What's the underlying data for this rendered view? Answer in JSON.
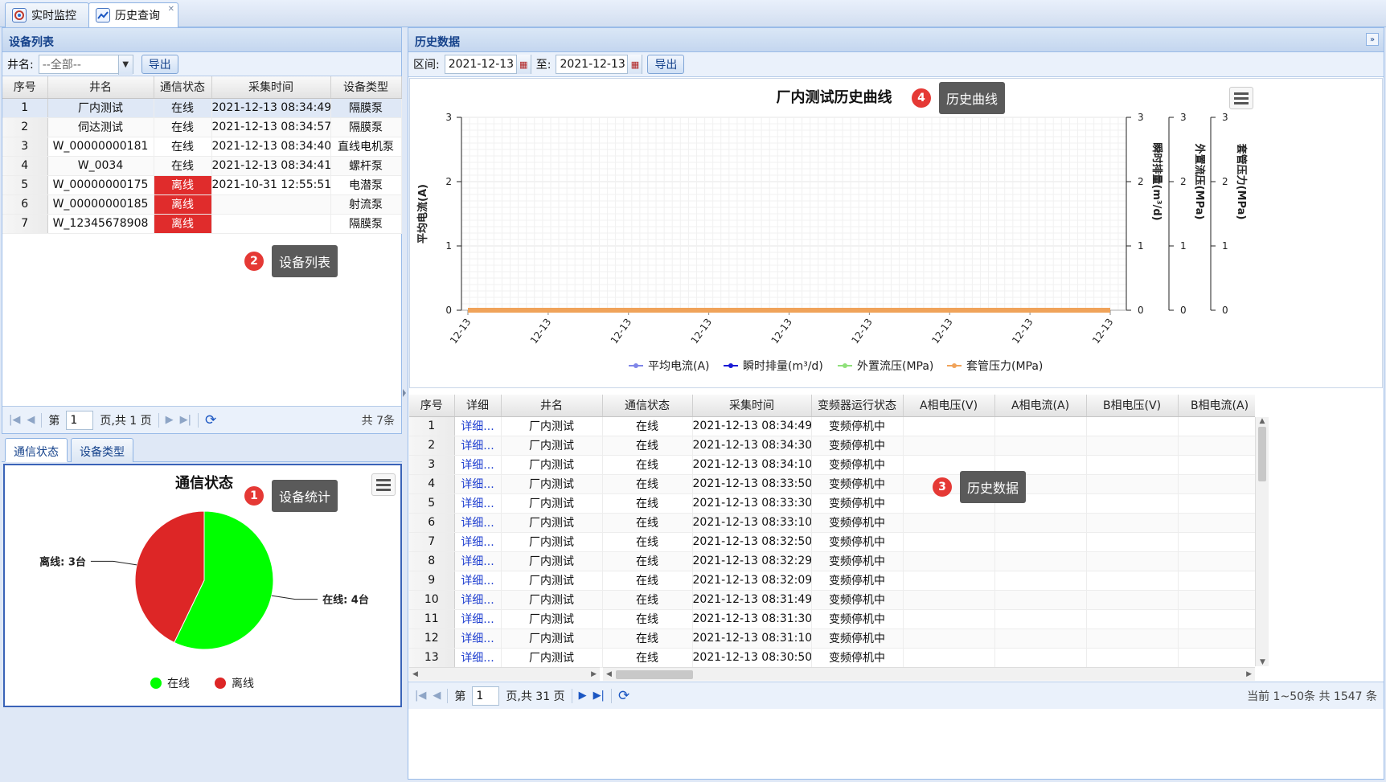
{
  "tabs": [
    {
      "label": "实时监控",
      "icon": "monitor-icon"
    },
    {
      "label": "历史查询",
      "icon": "line-chart-icon"
    }
  ],
  "device_panel": {
    "title": "设备列表",
    "filter_label": "井名:",
    "filter_value": "--全部--",
    "export_label": "导出",
    "columns": [
      "序号",
      "井名",
      "通信状态",
      "采集时间",
      "设备类型"
    ],
    "rows": [
      {
        "no": "1",
        "name": "厂内测试",
        "status": "在线",
        "time": "2021-12-13 08:34:49",
        "type": "隔膜泵"
      },
      {
        "no": "2",
        "name": "伺达测试",
        "status": "在线",
        "time": "2021-12-13 08:34:57",
        "type": "隔膜泵"
      },
      {
        "no": "3",
        "name": "W_00000000181",
        "status": "在线",
        "time": "2021-12-13 08:34:40",
        "type": "直线电机泵"
      },
      {
        "no": "4",
        "name": "W_0034",
        "status": "在线",
        "time": "2021-12-13 08:34:41",
        "type": "螺杆泵"
      },
      {
        "no": "5",
        "name": "W_00000000175",
        "status": "离线",
        "time": "2021-10-31 12:55:51",
        "type": "电潜泵"
      },
      {
        "no": "6",
        "name": "W_00000000185",
        "status": "离线",
        "time": "",
        "type": "射流泵"
      },
      {
        "no": "7",
        "name": "W_12345678908",
        "status": "离线",
        "time": "",
        "type": "隔膜泵"
      }
    ],
    "pager": {
      "page_prefix": "第",
      "page_value": "1",
      "page_suffix": "页,共 1 页",
      "total": "共 7条"
    }
  },
  "stats_panel": {
    "tabs": [
      "通信状态",
      "设备类型"
    ],
    "chart_title": "通信状态",
    "legend": [
      "在线",
      "离线"
    ],
    "labels": [
      "离线: 3台",
      "在线: 4台"
    ]
  },
  "history_panel": {
    "title": "历史数据",
    "range_label": "区间:",
    "start_date": "2021-12-13",
    "to_label": "至:",
    "end_date": "2021-12-13",
    "export_label": "导出",
    "chart_title": "厂内测试历史曲线",
    "y_axis_left": "平均电流(A)",
    "y_axis_right": [
      "瞬时排量(m³/d)",
      "外置流压(MPa)",
      "套管压力(MPa)"
    ],
    "legend": [
      "平均电流(A)",
      "瞬时排量(m³/d)",
      "外置流压(MPa)",
      "套管压力(MPa)"
    ],
    "x_tick_label": "12-13",
    "y_ticks": [
      "0",
      "1",
      "2",
      "3"
    ],
    "columns": [
      "序号",
      "详细",
      "井名",
      "通信状态",
      "采集时间",
      "变频器运行状态",
      "A相电压(V)",
      "A相电流(A)",
      "B相电压(V)",
      "B相电流(A)"
    ],
    "rows": [
      {
        "no": "1",
        "detail": "详细...",
        "name": "厂内测试",
        "status": "在线",
        "time": "2021-12-13 08:34:49",
        "vfd": "变频停机中"
      },
      {
        "no": "2",
        "detail": "详细...",
        "name": "厂内测试",
        "status": "在线",
        "time": "2021-12-13 08:34:30",
        "vfd": "变频停机中"
      },
      {
        "no": "3",
        "detail": "详细...",
        "name": "厂内测试",
        "status": "在线",
        "time": "2021-12-13 08:34:10",
        "vfd": "变频停机中"
      },
      {
        "no": "4",
        "detail": "详细...",
        "name": "厂内测试",
        "status": "在线",
        "time": "2021-12-13 08:33:50",
        "vfd": "变频停机中"
      },
      {
        "no": "5",
        "detail": "详细...",
        "name": "厂内测试",
        "status": "在线",
        "time": "2021-12-13 08:33:30",
        "vfd": "变频停机中"
      },
      {
        "no": "6",
        "detail": "详细...",
        "name": "厂内测试",
        "status": "在线",
        "time": "2021-12-13 08:33:10",
        "vfd": "变频停机中"
      },
      {
        "no": "7",
        "detail": "详细...",
        "name": "厂内测试",
        "status": "在线",
        "time": "2021-12-13 08:32:50",
        "vfd": "变频停机中"
      },
      {
        "no": "8",
        "detail": "详细...",
        "name": "厂内测试",
        "status": "在线",
        "time": "2021-12-13 08:32:29",
        "vfd": "变频停机中"
      },
      {
        "no": "9",
        "detail": "详细...",
        "name": "厂内测试",
        "status": "在线",
        "time": "2021-12-13 08:32:09",
        "vfd": "变频停机中"
      },
      {
        "no": "10",
        "detail": "详细...",
        "name": "厂内测试",
        "status": "在线",
        "time": "2021-12-13 08:31:49",
        "vfd": "变频停机中"
      },
      {
        "no": "11",
        "detail": "详细...",
        "name": "厂内测试",
        "status": "在线",
        "time": "2021-12-13 08:31:30",
        "vfd": "变频停机中"
      },
      {
        "no": "12",
        "detail": "详细...",
        "name": "厂内测试",
        "status": "在线",
        "time": "2021-12-13 08:31:10",
        "vfd": "变频停机中"
      },
      {
        "no": "13",
        "detail": "详细...",
        "name": "厂内测试",
        "status": "在线",
        "time": "2021-12-13 08:30:50",
        "vfd": "变频停机中"
      }
    ],
    "pager": {
      "page_prefix": "第",
      "page_value": "1",
      "page_suffix": "页,共 31 页",
      "total": "当前 1~50条 共 1547 条"
    }
  },
  "callouts": [
    {
      "num": "1",
      "text": "设备统计"
    },
    {
      "num": "2",
      "text": "设备列表"
    },
    {
      "num": "3",
      "text": "历史数据"
    },
    {
      "num": "4",
      "text": "历史曲线"
    }
  ],
  "chart_data": [
    {
      "type": "pie",
      "title": "通信状态",
      "categories": [
        "在线",
        "离线"
      ],
      "values": [
        4,
        3
      ],
      "colors": [
        "#00ff00",
        "#dd2626"
      ],
      "data_labels": [
        "在线: 4台",
        "离线: 3台"
      ],
      "legend": "bottom"
    },
    {
      "type": "line",
      "title": "厂内测试历史曲线",
      "x": [
        "12-13",
        "12-13",
        "12-13",
        "12-13",
        "12-13",
        "12-13",
        "12-13",
        "12-13",
        "12-13"
      ],
      "series": [
        {
          "name": "平均电流(A)",
          "values": [
            0,
            0,
            0,
            0,
            0,
            0,
            0,
            0,
            0
          ],
          "color": "#7f86e8"
        },
        {
          "name": "瞬时排量(m³/d)",
          "values": [
            0,
            0,
            0,
            0,
            0,
            0,
            0,
            0,
            0
          ],
          "color": "#1a1ad6"
        },
        {
          "name": "外置流压(MPa)",
          "values": [
            0,
            0,
            0,
            0,
            0,
            0,
            0,
            0,
            0
          ],
          "color": "#8fe07a"
        },
        {
          "name": "套管压力(MPa)",
          "values": [
            0,
            0,
            0,
            0,
            0,
            0,
            0,
            0,
            0
          ],
          "color": "#f0a35a"
        }
      ],
      "ylim": [
        0,
        3
      ],
      "ylabel": "平均电流(A)",
      "grid": true,
      "legend": "bottom"
    }
  ]
}
